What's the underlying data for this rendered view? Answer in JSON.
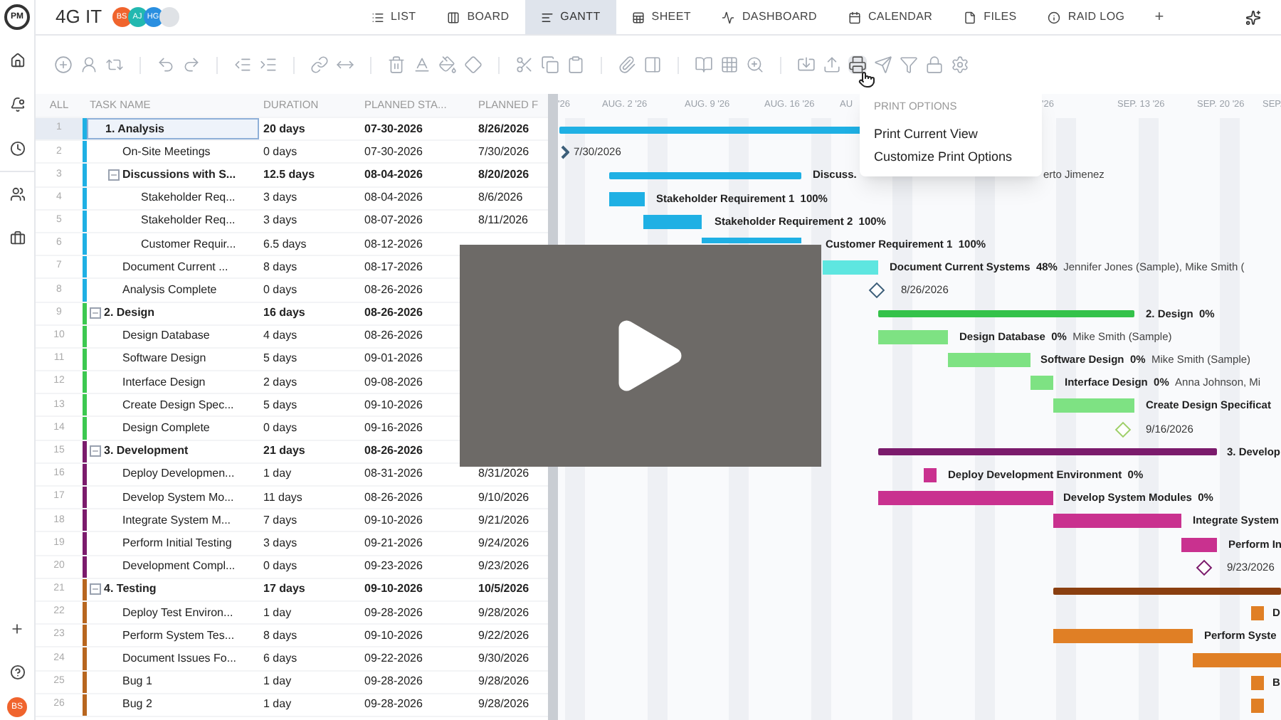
{
  "app": {
    "logo": "PM",
    "project": "4G IT",
    "members": [
      {
        "initials": "BS",
        "color": "#f0642d"
      },
      {
        "initials": "AJ",
        "color": "#22b8b0"
      },
      {
        "initials": "HG",
        "color": "#2a8fe0"
      }
    ]
  },
  "tabs": [
    {
      "label": "LIST",
      "selected": false
    },
    {
      "label": "BOARD",
      "selected": false
    },
    {
      "label": "GANTT",
      "selected": true
    },
    {
      "label": "SHEET",
      "selected": false
    },
    {
      "label": "DASHBOARD",
      "selected": false
    },
    {
      "label": "CALENDAR",
      "selected": false
    },
    {
      "label": "FILES",
      "selected": false
    },
    {
      "label": "RAID LOG",
      "selected": false
    }
  ],
  "add_tab": "+",
  "user_avatar": {
    "initials": "BS",
    "color": "#f0642d"
  },
  "table": {
    "columns": [
      "ALL",
      "TASK NAME",
      "DURATION",
      "PLANNED STA...",
      "PLANNED F"
    ],
    "tasks": [
      {
        "num": "1",
        "name": "1. Analysis",
        "duration": "20 days",
        "start": "07-30-2026",
        "finish": "8/26/2026",
        "selected": true,
        "color": "#1fb0e4",
        "children": [
          {
            "num": "2",
            "name": "On-Site Meetings",
            "duration": "0 days",
            "start": "07-30-2026",
            "finish": "7/30/2026",
            "selected": false
          },
          {
            "num": "3",
            "name": "Discussions with S...",
            "duration": "12.5 days",
            "start": "08-04-2026",
            "finish": "8/20/2026",
            "selected": false,
            "expanded": true,
            "children": [
              {
                "num": "4",
                "name": "Stakeholder Req...",
                "duration": "3 days",
                "start": "08-04-2026",
                "finish": "8/6/2026",
                "selected": false
              },
              {
                "num": "5",
                "name": "Stakeholder Req...",
                "duration": "3 days",
                "start": "08-07-2026",
                "finish": "8/11/2026",
                "selected": false
              },
              {
                "num": "6",
                "name": "Customer Requir...",
                "duration": "6.5 days",
                "start": "08-12-2026",
                "selected": false
              }
            ]
          },
          {
            "num": "7",
            "name": "Document Current ...",
            "duration": "8 days",
            "start": "08-17-2026",
            "selected": false
          },
          {
            "num": "8",
            "name": "Analysis Complete",
            "duration": "0 days",
            "start": "08-26-2026",
            "selected": false
          }
        ]
      },
      {
        "num": "9",
        "name": "2. Design",
        "duration": "16 days",
        "start": "08-26-2026",
        "selected": false,
        "expanded": true,
        "color": "#3cc850",
        "children": [
          {
            "num": "10",
            "name": "Design Database",
            "duration": "4 days",
            "start": "08-26-2026",
            "selected": false
          },
          {
            "num": "11",
            "name": "Software Design",
            "duration": "5 days",
            "start": "09-01-2026",
            "selected": false
          },
          {
            "num": "12",
            "name": "Interface Design",
            "duration": "2 days",
            "start": "09-08-2026",
            "selected": false
          },
          {
            "num": "13",
            "name": "Create Design Spec...",
            "duration": "5 days",
            "start": "09-10-2026",
            "selected": false
          },
          {
            "num": "14",
            "name": "Design Complete",
            "duration": "0 days",
            "start": "09-16-2026",
            "selected": false
          }
        ]
      },
      {
        "num": "15",
        "name": "3. Development",
        "duration": "21 days",
        "start": "08-26-2026",
        "selected": false,
        "expanded": true,
        "color": "#7b1b6c",
        "children": [
          {
            "num": "16",
            "name": "Deploy Developmen...",
            "duration": "1 day",
            "start": "08-31-2026",
            "finish": "8/31/2026",
            "selected": false
          },
          {
            "num": "17",
            "name": "Develop System Mo...",
            "duration": "11 days",
            "start": "08-26-2026",
            "finish": "9/10/2026",
            "selected": false
          },
          {
            "num": "18",
            "name": "Integrate System M...",
            "duration": "7 days",
            "start": "09-10-2026",
            "finish": "9/21/2026",
            "selected": false
          },
          {
            "num": "19",
            "name": "Perform Initial Testing",
            "duration": "3 days",
            "start": "09-21-2026",
            "finish": "9/24/2026",
            "selected": false
          },
          {
            "num": "20",
            "name": "Development Compl...",
            "duration": "0 days",
            "start": "09-23-2026",
            "finish": "9/23/2026",
            "selected": false
          }
        ]
      },
      {
        "num": "21",
        "name": "4. Testing",
        "duration": "17 days",
        "start": "09-10-2026",
        "finish": "10/5/2026",
        "selected": false,
        "expanded": true,
        "color": "#b8661f",
        "children": [
          {
            "num": "22",
            "name": "Deploy Test Environ...",
            "duration": "1 day",
            "start": "09-28-2026",
            "finish": "9/28/2026",
            "selected": false
          },
          {
            "num": "23",
            "name": "Perform System Tes...",
            "duration": "8 days",
            "start": "09-10-2026",
            "finish": "9/22/2026",
            "selected": false
          },
          {
            "num": "24",
            "name": "Document Issues Fo...",
            "duration": "6 days",
            "start": "09-22-2026",
            "finish": "9/30/2026",
            "selected": false
          },
          {
            "num": "25",
            "name": "Bug 1",
            "duration": "1 day",
            "start": "09-28-2026",
            "finish": "9/28/2026",
            "selected": false
          },
          {
            "num": "26",
            "name": "Bug 2",
            "duration": "1 day",
            "start": "09-28-2026",
            "finish": "9/28/2026",
            "selected": false
          }
        ]
      }
    ]
  },
  "gantt": {
    "weeks": [
      "'26",
      "AUG. 2 '26",
      "AUG. 9 '26",
      "AUG. 16 '26",
      "AU",
      "'26",
      "SEP. 13 '26",
      "SEP. 20 '26",
      "SEP."
    ],
    "bars": [
      {
        "kind": "summary",
        "color": "#1fb0e4"
      },
      {
        "kind": "start",
        "color": "#3d5f7a",
        "label": "7/30/2026"
      },
      {
        "kind": "summary",
        "color": "#1fb0e4",
        "label": "Discuss.",
        "people": "erto Jimenez"
      },
      {
        "kind": "task",
        "color": "#1fb0e4",
        "label": "Stakeholder Requirement 1",
        "percent": "100%"
      },
      {
        "kind": "task",
        "color": "#1fb0e4",
        "label": "Stakeholder Requirement 2",
        "percent": "100%"
      },
      {
        "kind": "task",
        "color": "#1fb0e4",
        "label": "Customer Requirement 1",
        "percent": "100%"
      },
      {
        "kind": "task",
        "color": "#5ee6e0",
        "label": "Document Current Systems",
        "percent": "48%",
        "people": "Jennifer Jones (Sample), Mike Smith ("
      },
      {
        "kind": "milestone",
        "color": "#3d5f7a",
        "label": "8/26/2026"
      },
      {
        "kind": "summary",
        "color": "#34c24a",
        "label": "2. Design",
        "percent": "0%"
      },
      {
        "kind": "task",
        "color": "#7ee283",
        "label": "Design Database",
        "percent": "0%",
        "people": "Mike Smith (Sample)"
      },
      {
        "kind": "task",
        "color": "#7ee283",
        "label": "Software Design",
        "percent": "0%",
        "people": "Mike Smith (Sample)"
      },
      {
        "kind": "task",
        "color": "#7ee283",
        "label": "Interface Design",
        "percent": "0%",
        "people": "Anna Johnson, Mi"
      },
      {
        "kind": "task",
        "color": "#7ee283",
        "label": "Create Design Specificat"
      },
      {
        "kind": "milestone",
        "color": "#9fcf6a",
        "label": "9/16/2026"
      },
      {
        "kind": "summary",
        "color": "#7b1b6c",
        "label": "3. Develop"
      },
      {
        "kind": "task",
        "color": "#c9318f",
        "label": "Deploy Development Environment",
        "percent": "0%"
      },
      {
        "kind": "task",
        "color": "#c9318f",
        "label": "Develop System Modules",
        "percent": "0%"
      },
      {
        "kind": "task",
        "color": "#c9318f",
        "label": "Integrate System"
      },
      {
        "kind": "task",
        "color": "#c9318f",
        "label": "Perform In"
      },
      {
        "kind": "milestone",
        "color": "#7b1b6c",
        "label": "9/23/2026"
      },
      {
        "kind": "summary",
        "color": "#8a3f10"
      },
      {
        "kind": "task",
        "color": "#e07f25",
        "label": "D"
      },
      {
        "kind": "task",
        "color": "#e07f25",
        "label": "Perform Syste"
      },
      {
        "kind": "task",
        "color": "#e07f25"
      },
      {
        "kind": "task",
        "color": "#e07f25",
        "label": "B"
      },
      {
        "kind": "task",
        "color": "#e07f25"
      }
    ]
  },
  "print_menu": {
    "title": "PRINT OPTIONS",
    "items": [
      "Print Current View",
      "Customize Print Options"
    ]
  }
}
